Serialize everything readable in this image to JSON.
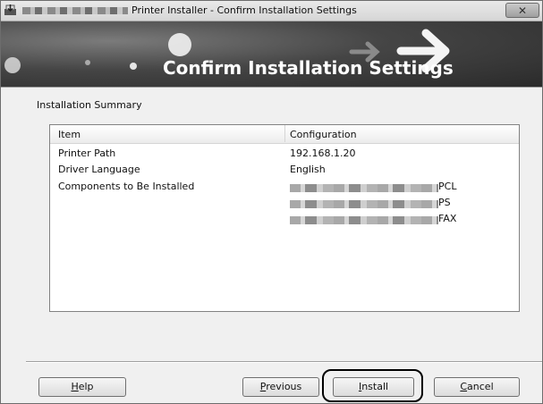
{
  "window": {
    "title": "Printer Installer - Confirm Installation Settings",
    "close_label": "✕"
  },
  "banner": {
    "title": "Confirm Installation Settings"
  },
  "summary": {
    "label": "Installation Summary",
    "columns": [
      "Item",
      "Configuration"
    ],
    "rows": [
      {
        "item": "Printer Path",
        "value": "192.168.1.20"
      },
      {
        "item": "Driver Language",
        "value": "English"
      },
      {
        "item": "Components to Be Installed",
        "value": "PCL"
      }
    ],
    "extra_components": [
      "PS",
      "FAX"
    ]
  },
  "buttons": {
    "help": {
      "underline": "H",
      "rest": "elp"
    },
    "previous": {
      "underline": "P",
      "rest": "revious"
    },
    "install": {
      "underline": "I",
      "rest": "nstall"
    },
    "cancel": {
      "underline": "C",
      "rest": "ancel"
    }
  }
}
